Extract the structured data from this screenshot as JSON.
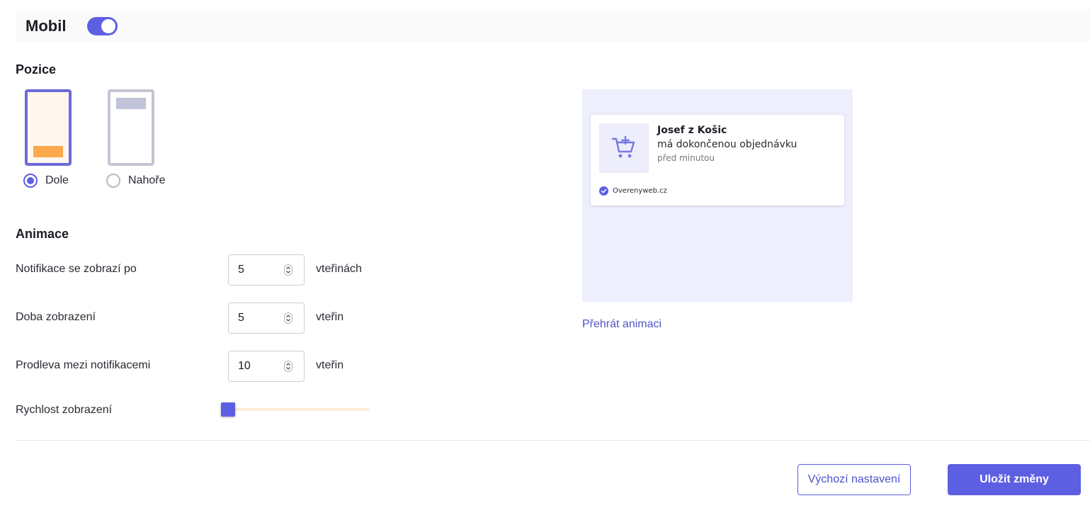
{
  "header": {
    "title": "Mobil",
    "toggle_on": true
  },
  "colors": {
    "accent": "#5d5fe3",
    "highlight": "#fba94c",
    "preview_bg": "#eeeffd"
  },
  "position": {
    "title": "Pozice",
    "options": [
      {
        "label": "Dole",
        "selected": true
      },
      {
        "label": "Nahoře",
        "selected": false
      }
    ]
  },
  "animation": {
    "title": "Animace",
    "rows": [
      {
        "label": "Notifikace se zobrazí po",
        "value": "5",
        "unit": "vteřinách"
      },
      {
        "label": "Doba zobrazení",
        "value": "5",
        "unit": "vteřin"
      },
      {
        "label": "Prodleva mezi notifikacemi",
        "value": "10",
        "unit": "vteřin"
      }
    ],
    "speed": {
      "label": "Rychlost zobrazení",
      "value": 0
    }
  },
  "preview": {
    "name": "Josef z Košic",
    "action": "má dokončenou objednávku",
    "time": "před minutou",
    "brand": "Overenyweb.cz",
    "icon": "cart-plus-icon",
    "play_label": "Přehrát animaci"
  },
  "footer": {
    "reset_label": "Výchozí nastavení",
    "save_label": "Uložit změny"
  }
}
